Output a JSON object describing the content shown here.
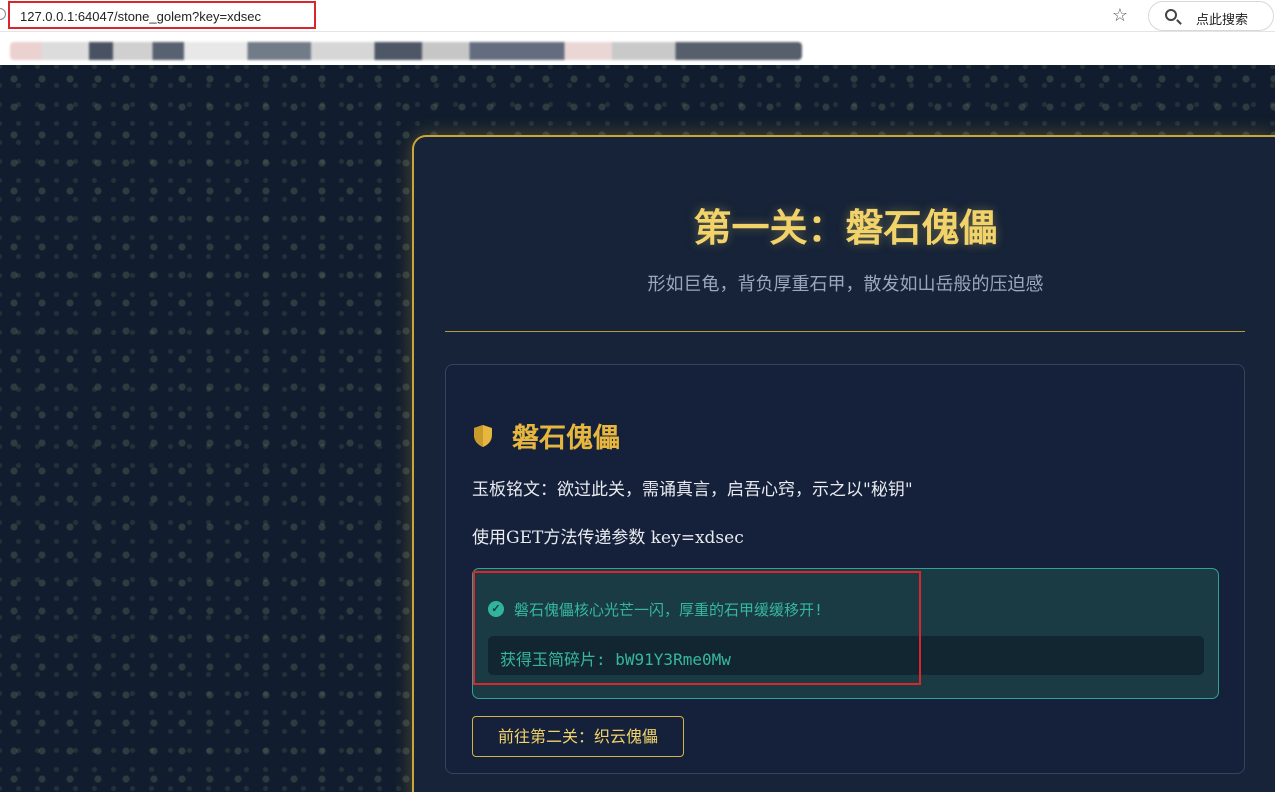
{
  "browser": {
    "url": "127.0.0.1:64047/stone_golem?key=xdsec",
    "search_label": "点此搜索"
  },
  "page": {
    "title": "第一关：磐石傀儡",
    "subtitle": "形如巨龟，背负厚重石甲，散发如山岳般的压迫感"
  },
  "panel": {
    "heading": "磐石傀儡",
    "inscription": "玉板铭文：欲过此关，需诵真言，启吾心窍，示之以\"秘钥\"",
    "hint": "使用GET方法传递参数 key=xdsec",
    "success_message": "磐石傀儡核心光芒一闪，厚重的石甲缓缓移开!",
    "fragment": "获得玉简碎片: bW91Y3Rme0Mw",
    "next_button": "前往第二关：织云傀儡"
  },
  "colors": {
    "accent_gold": "#f1d36a",
    "success_teal": "#35b89e",
    "highlight_red": "#d9262c"
  }
}
